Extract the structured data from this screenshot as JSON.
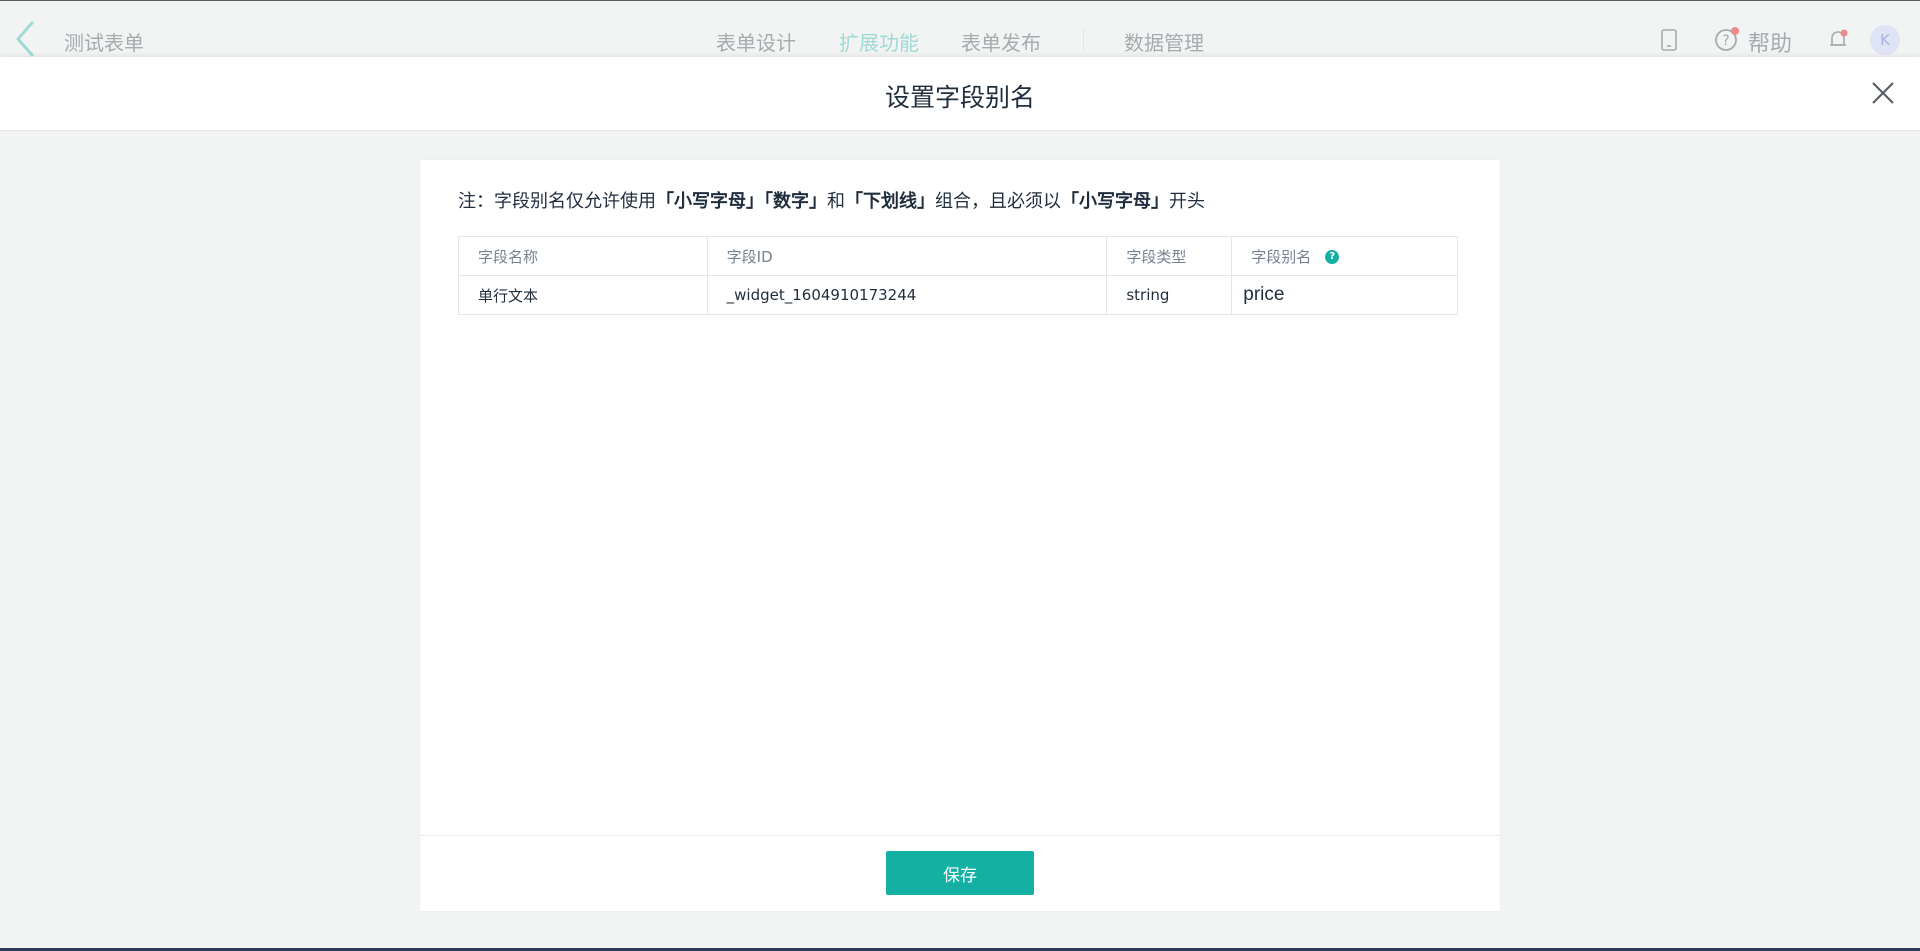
{
  "topbar": {
    "app_title": "测试表单",
    "nav": [
      {
        "label": "表单设计"
      },
      {
        "label": "扩展功能"
      },
      {
        "label": "表单发布"
      },
      {
        "label": "数据管理"
      }
    ],
    "help_label": "帮助",
    "avatar_initial": "K",
    "icons": [
      "back-chevron-icon",
      "mobile-preview-icon",
      "help-circle-icon",
      "notification-bell-icon"
    ]
  },
  "modal": {
    "title": "设置字段别名",
    "close_icon": "close-icon"
  },
  "note": {
    "prefix": "注：字段别名仅允许使用",
    "part1": "「小写字母」「数字」",
    "mid1": "和",
    "part2": "「下划线」",
    "mid2": "组合，且必须以",
    "part3": "「小写字母」",
    "suffix": "开头"
  },
  "table": {
    "headers": [
      "字段名称",
      "字段ID",
      "字段类型",
      "字段别名"
    ],
    "rows": [
      {
        "name": "单行文本",
        "id": "_widget_1604910173244",
        "type": "string",
        "alias": "price"
      }
    ]
  },
  "footer": {
    "save_label": "保存"
  },
  "colors": {
    "accent": "#14b0a4",
    "nav_active": "#9fdad4"
  }
}
